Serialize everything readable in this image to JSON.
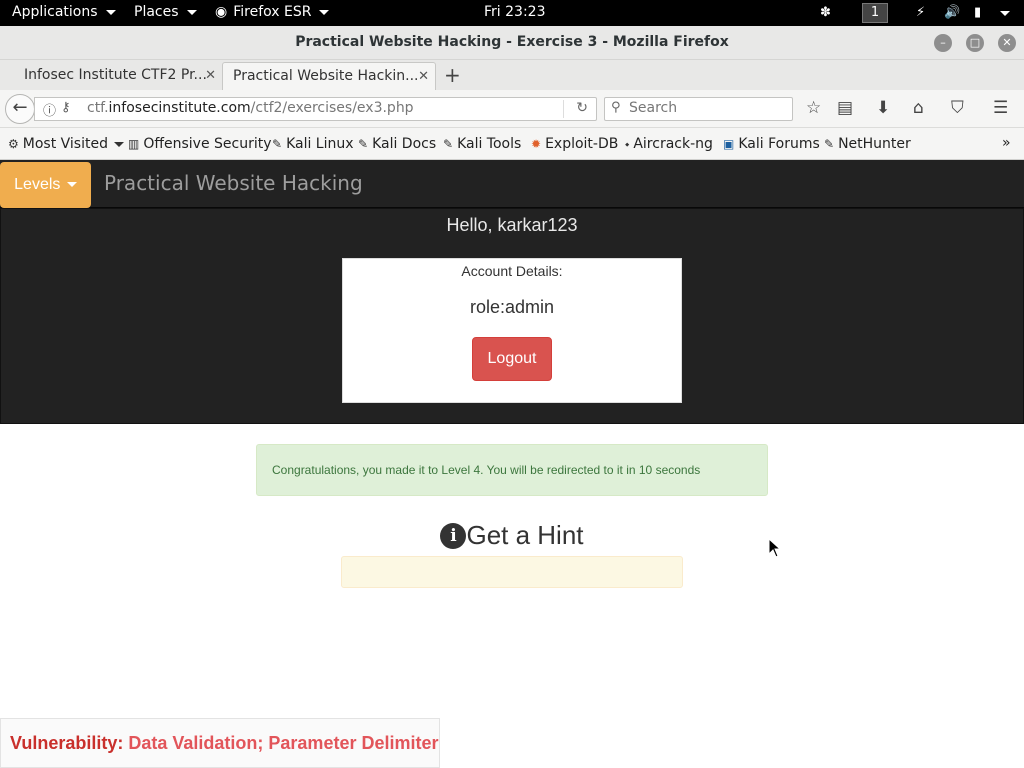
{
  "topbar": {
    "applications": "Applications",
    "places": "Places",
    "firefox": "Firefox ESR",
    "clock": "Fri 23:23",
    "workspace": "1"
  },
  "window": {
    "title": "Practical Website Hacking - Exercise 3 - Mozilla Firefox"
  },
  "tabs": [
    {
      "label": "Infosec Institute CTF2 Pr..."
    },
    {
      "label": "Practical Website Hackin..."
    }
  ],
  "nav": {
    "url_prefix": "ctf.",
    "url_host": "infosecinstitute.com",
    "url_path": "/ctf2/exercises/ex3.php",
    "search_placeholder": "Search"
  },
  "bookmarks": [
    {
      "label": "Most Visited",
      "icon": "gear-icon"
    },
    {
      "label": "Offensive Security",
      "icon": "offsec-icon"
    },
    {
      "label": "Kali Linux",
      "icon": "kali-icon"
    },
    {
      "label": "Kali Docs",
      "icon": "kali-icon"
    },
    {
      "label": "Kali Tools",
      "icon": "kali-icon"
    },
    {
      "label": "Exploit-DB",
      "icon": "exploitdb-icon"
    },
    {
      "label": "Aircrack-ng",
      "icon": "aircrack-icon"
    },
    {
      "label": "Kali Forums",
      "icon": "forum-icon"
    },
    {
      "label": "NetHunter",
      "icon": "kali-icon"
    }
  ],
  "site": {
    "levels": "Levels",
    "brand": "Practical Website Hacking",
    "hello": "Hello, karkar123",
    "account_label": "Account Details:",
    "role": "role:admin",
    "logout": "Logout",
    "alert": "Congratulations, you made it to Level 4. You will be redirected to it in 10 seconds",
    "hint": "Get a Hint",
    "vuln_key": "Vulnerability:",
    "vuln_value": "Data Validation; Parameter Delimiter"
  },
  "colors": {
    "levels_button": "#f0ad4e",
    "logout_button": "#d9534f",
    "alert_bg": "#dff0d8",
    "navbar_bg": "#222222"
  }
}
